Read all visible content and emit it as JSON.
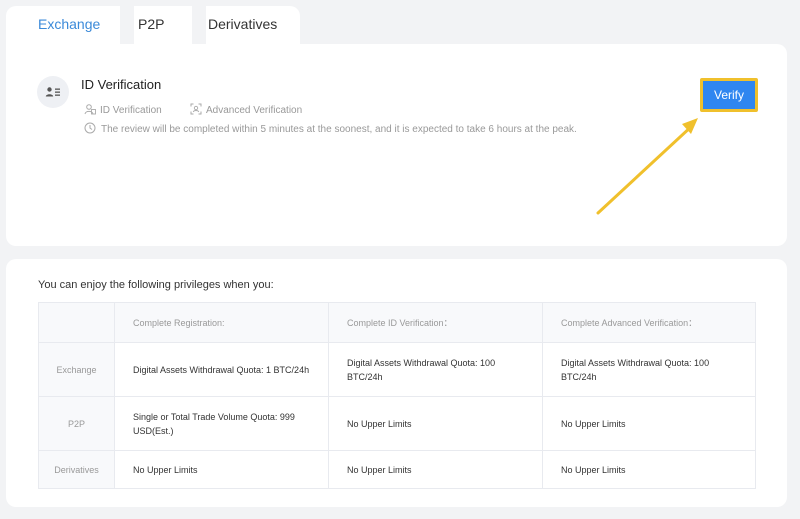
{
  "tabs": [
    {
      "label": "Exchange"
    },
    {
      "label": "P2P"
    },
    {
      "label": "Derivatives"
    }
  ],
  "verification": {
    "title": "ID Verification",
    "level_id": "ID Verification",
    "level_advanced": "Advanced Verification",
    "note": "The review will be completed within 5 minutes at the soonest, and it is expected to take 6 hours at the peak.",
    "verify_label": "Verify"
  },
  "privileges": {
    "heading": "You can enjoy the following privileges when you:",
    "columns": [
      "Complete Registration:",
      "Complete ID Verification：",
      "Complete Advanced Verification："
    ],
    "rows": [
      {
        "label": "Exchange",
        "cells": [
          "Digital Assets Withdrawal Quota: 1 BTC/24h",
          "Digital Assets Withdrawal Quota: 100 BTC/24h",
          "Digital Assets Withdrawal Quota: 100 BTC/24h"
        ]
      },
      {
        "label": "P2P",
        "cells": [
          "Single or Total Trade Volume Quota: 999 USD(Est.)",
          "No Upper Limits",
          "No Upper Limits"
        ]
      },
      {
        "label": "Derivatives",
        "cells": [
          "No Upper Limits",
          "No Upper Limits",
          "No Upper Limits"
        ]
      }
    ]
  },
  "colors": {
    "accent": "#3b8ad9",
    "button": "#2f86f0",
    "highlight": "#f0c02c"
  }
}
